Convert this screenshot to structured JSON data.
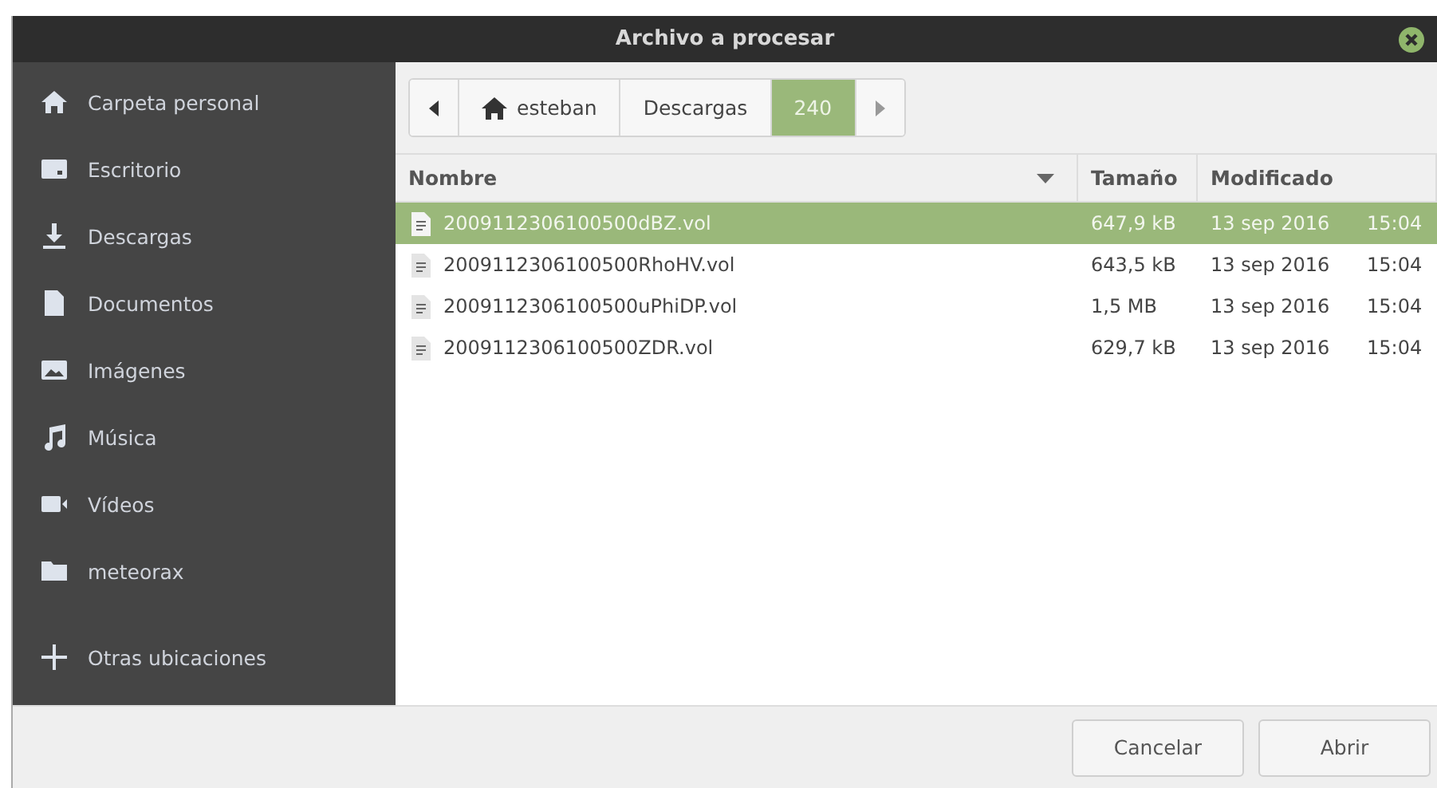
{
  "window": {
    "title": "Archivo a procesar"
  },
  "sidebar": {
    "items": [
      {
        "kind": "home",
        "label": "Carpeta personal"
      },
      {
        "kind": "desktop",
        "label": "Escritorio"
      },
      {
        "kind": "download",
        "label": "Descargas"
      },
      {
        "kind": "document",
        "label": "Documentos"
      },
      {
        "kind": "image",
        "label": "Imágenes"
      },
      {
        "kind": "music",
        "label": "Música"
      },
      {
        "kind": "video",
        "label": "Vídeos"
      },
      {
        "kind": "folder",
        "label": "meteorax"
      },
      {
        "kind": "other",
        "label": "Otras ubicaciones"
      }
    ]
  },
  "path_bar": {
    "crumbs": [
      {
        "label": "esteban",
        "home": true,
        "selected": false
      },
      {
        "label": "Descargas",
        "home": false,
        "selected": false
      },
      {
        "label": "240",
        "home": false,
        "selected": true
      }
    ]
  },
  "table": {
    "columns": [
      "Nombre",
      "Tamaño",
      "Modificado"
    ],
    "rows": [
      {
        "name": "2009112306100500dBZ.vol",
        "size": "647,9 kB",
        "date": "13 sep 2016",
        "time": "15:04",
        "selected": true
      },
      {
        "name": "2009112306100500RhoHV.vol",
        "size": "643,5 kB",
        "date": "13 sep 2016",
        "time": "15:04",
        "selected": false
      },
      {
        "name": "2009112306100500uPhiDP.vol",
        "size": "1,5 MB",
        "date": "13 sep 2016",
        "time": "15:04",
        "selected": false
      },
      {
        "name": "2009112306100500ZDR.vol",
        "size": "629,7 kB",
        "date": "13 sep 2016",
        "time": "15:04",
        "selected": false
      }
    ]
  },
  "buttons": [
    "Cancelar",
    "Abrir"
  ]
}
